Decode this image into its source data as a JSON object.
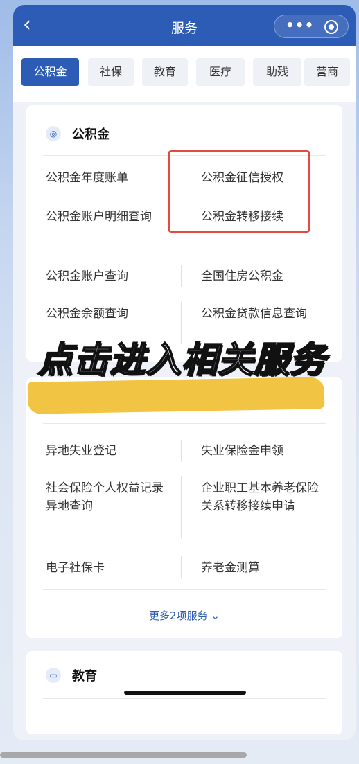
{
  "navbar": {
    "back_icon": "chevron-left-icon",
    "title": "服务",
    "more_icon": "more-dots-icon",
    "close_icon": "target-circle-icon"
  },
  "tabs": [
    {
      "label": "公积金",
      "active": true
    },
    {
      "label": "社保",
      "active": false
    },
    {
      "label": "教育",
      "active": false
    },
    {
      "label": "医疗",
      "active": false
    },
    {
      "label": "助残",
      "active": false
    },
    {
      "label": "营商",
      "active": false
    }
  ],
  "fund_card": {
    "icon": "fund-icon",
    "title": "公积金",
    "items": [
      "公积金年度账单",
      "公积金征信授权",
      "公积金账户明细查询",
      "公积金转移接续",
      "公积金账户查询",
      "全国住房公积金",
      "公积金余额查询",
      "公积金贷款信息查询"
    ]
  },
  "overlay": {
    "caption": "点击进入相关服务"
  },
  "social_card": {
    "items": [
      "异地失业登记",
      "失业保险金申领",
      "社会保险个人权益记录异地查询",
      "企业职工基本养老保险关系转移接续申请",
      "电子社保卡",
      "养老金测算"
    ],
    "more_label": "更多2项服务 ⌄"
  },
  "edu_card": {
    "icon": "book-icon",
    "title": "教育"
  },
  "colors": {
    "primary": "#2c5cb6",
    "highlight_box": "#e34b3e",
    "highlight_marker": "#f2c444"
  }
}
